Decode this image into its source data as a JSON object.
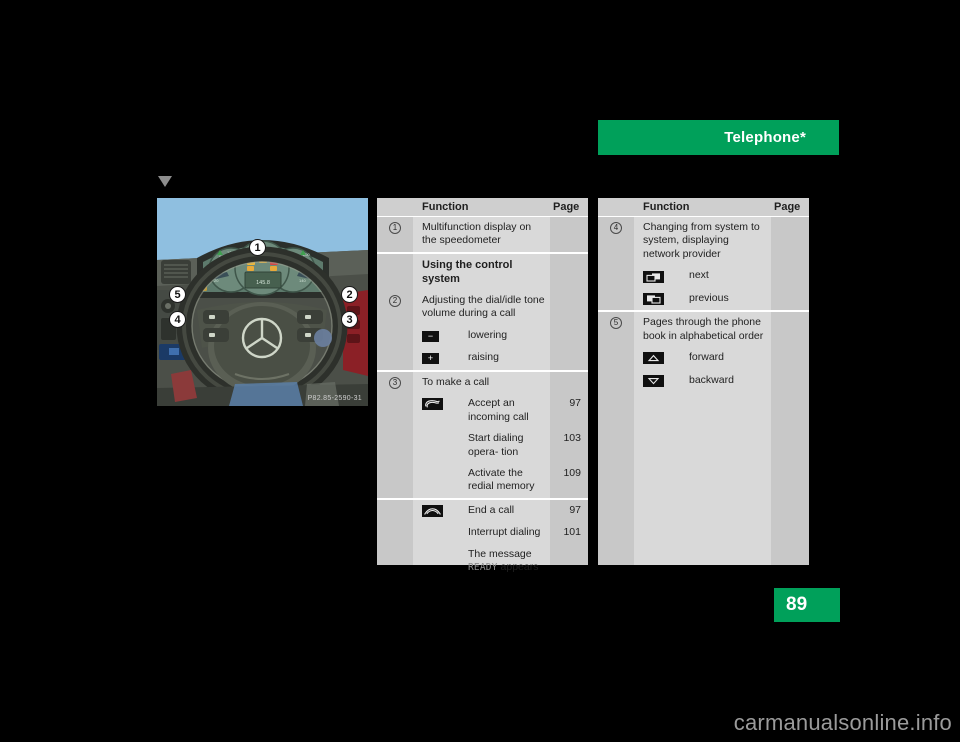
{
  "header": {
    "title": "Telephone*"
  },
  "page_number": "89",
  "watermark": "carmanualsonline.info",
  "illustration": {
    "name": "steering-wheel-controls",
    "code": "P82.85-2590-31",
    "callouts": [
      "1",
      "2",
      "3",
      "4",
      "5"
    ]
  },
  "tables": [
    {
      "id": "left",
      "headers": {
        "function": "Function",
        "page": "Page"
      },
      "groups": [
        {
          "rows": [
            {
              "num": "1",
              "text": "Multifunction display on the speedometer",
              "page": ""
            }
          ]
        },
        {
          "rows": [
            {
              "num": "",
              "text": "Using the control system",
              "page": "",
              "bold": true
            },
            {
              "num": "2",
              "text": "Adjusting the dial/idle tone volume during a call",
              "page": ""
            },
            {
              "num": "",
              "icon": "minus-button-icon",
              "text": "lowering",
              "page": "",
              "sub": true
            },
            {
              "num": "",
              "icon": "plus-button-icon",
              "text": "raising",
              "page": "",
              "sub": true
            }
          ]
        },
        {
          "rows": [
            {
              "num": "3",
              "text": "To make a call",
              "page": ""
            },
            {
              "num": "",
              "icon": "accept-call-icon",
              "text": "Accept an incoming call",
              "page": "97",
              "sub": true
            },
            {
              "num": "",
              "icon": "",
              "text": "Start dialing opera-\ntion",
              "page": "103",
              "sub": true
            },
            {
              "num": "",
              "icon": "",
              "text": "Activate the redial memory",
              "page": "109",
              "sub": true
            }
          ]
        },
        {
          "rows": [
            {
              "num": "",
              "icon": "end-call-icon",
              "text": "End a call",
              "page": "97",
              "sub": true
            },
            {
              "num": "",
              "icon": "",
              "text": "Interrupt dialing",
              "page": "101",
              "sub": true
            },
            {
              "num": "",
              "icon": "",
              "text": "The message",
              "text2": "READY",
              "text3": "appears",
              "page": "",
              "sub": true,
              "ready": true
            }
          ]
        }
      ]
    },
    {
      "id": "right",
      "headers": {
        "function": "Function",
        "page": "Page"
      },
      "groups": [
        {
          "rows": [
            {
              "num": "4",
              "text": "Changing from system to system, displaying network provider",
              "page": ""
            },
            {
              "num": "",
              "icon": "next-system-icon",
              "text": "next",
              "page": "",
              "sub": true
            },
            {
              "num": "",
              "icon": "previous-system-icon",
              "text": "previous",
              "page": "",
              "sub": true
            }
          ]
        },
        {
          "rows": [
            {
              "num": "5",
              "text": "Pages through the phone book in alphabetical order",
              "page": ""
            },
            {
              "num": "",
              "icon": "forward-arrow-icon",
              "text": "forward",
              "page": "",
              "sub": true
            },
            {
              "num": "",
              "icon": "backward-arrow-icon",
              "text": "backward",
              "page": "",
              "sub": true
            }
          ]
        }
      ]
    }
  ],
  "colors": {
    "brand_green": "#00a05a",
    "table_body": "#d9d9d9",
    "table_gutter": "#c8c8c8",
    "page_background": "#000000"
  }
}
